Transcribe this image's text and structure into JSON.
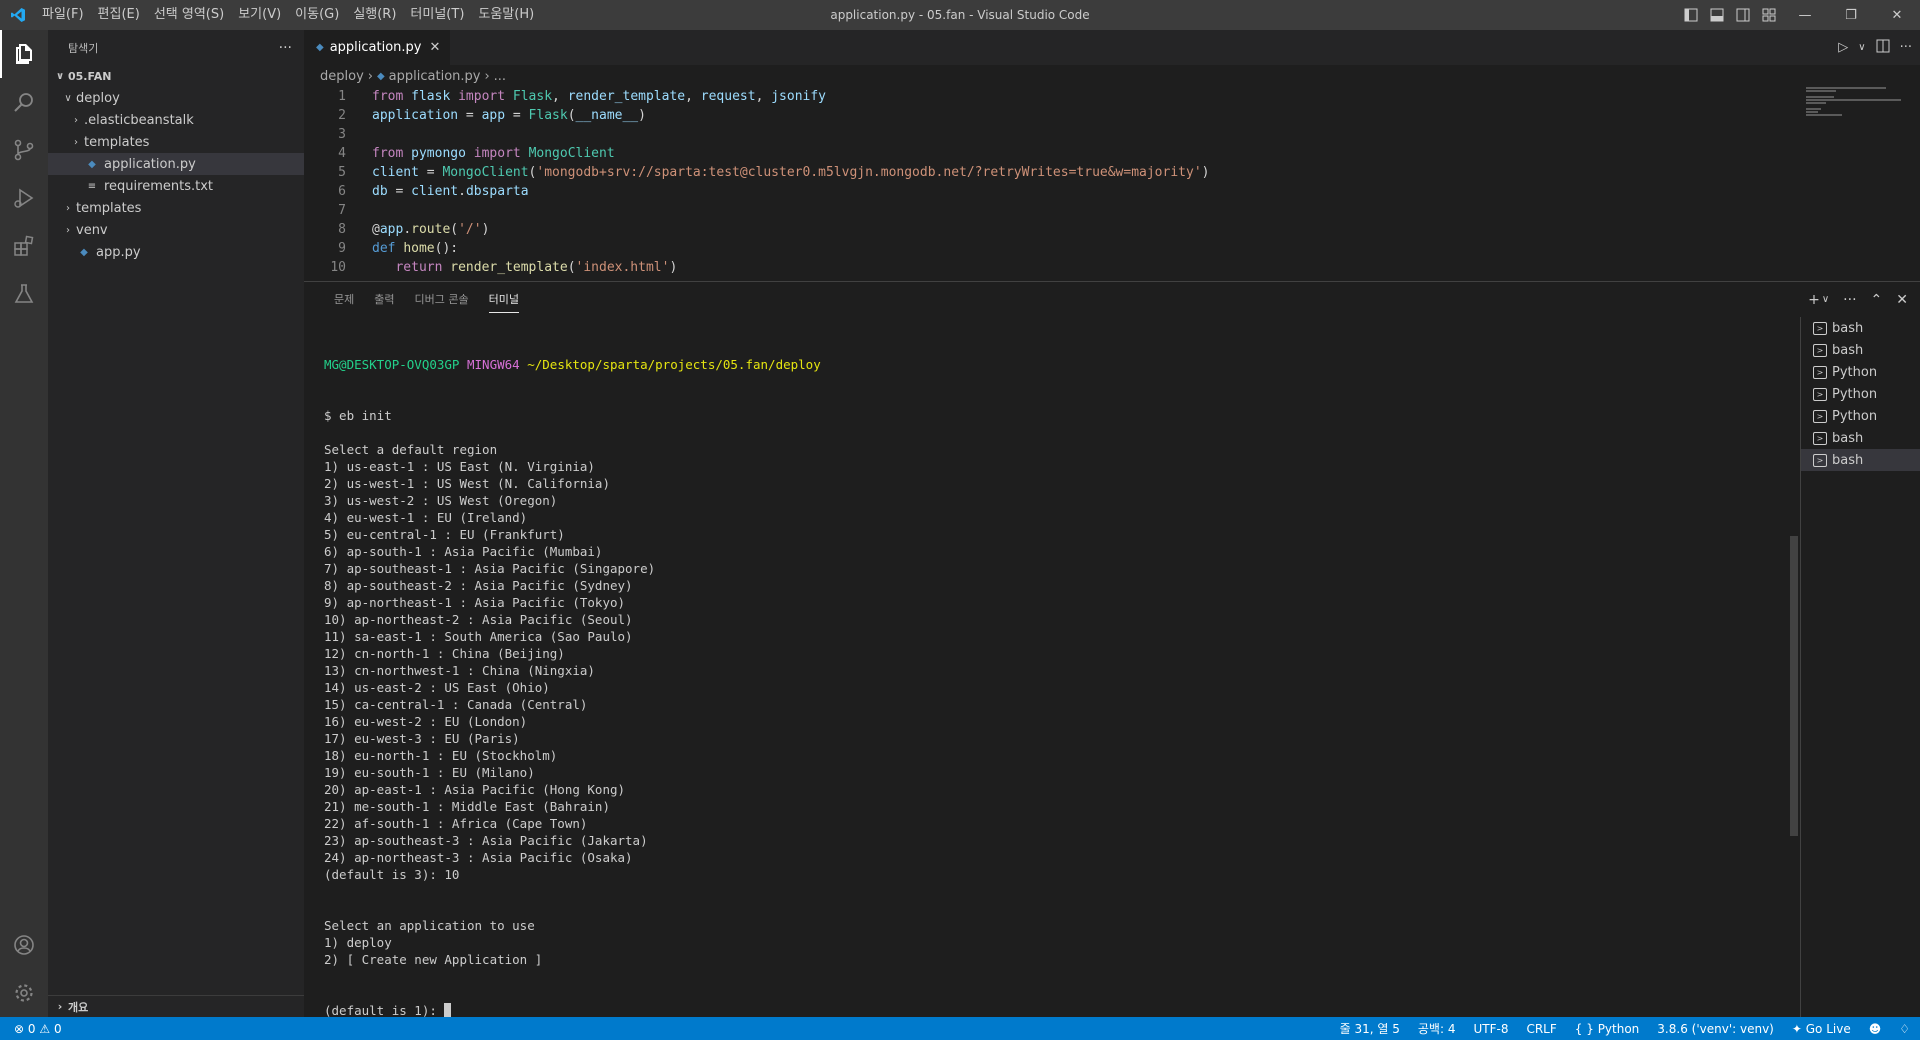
{
  "window": {
    "title": "application.py - 05.fan - Visual Studio Code",
    "menu": [
      "파일(F)",
      "편집(E)",
      "선택 영역(S)",
      "보기(V)",
      "이동(G)",
      "실행(R)",
      "터미널(T)",
      "도움말(H)"
    ]
  },
  "sidebar": {
    "title": "탐색기",
    "more": "···",
    "root": "05.FAN",
    "tree": [
      {
        "label": "deploy",
        "depth": 1,
        "type": "folder-open"
      },
      {
        "label": ".elasticbeanstalk",
        "depth": 2,
        "type": "folder"
      },
      {
        "label": "templates",
        "depth": 2,
        "type": "folder"
      },
      {
        "label": "application.py",
        "depth": 2,
        "type": "python",
        "selected": true
      },
      {
        "label": "requirements.txt",
        "depth": 2,
        "type": "text"
      },
      {
        "label": "templates",
        "depth": 1,
        "type": "folder"
      },
      {
        "label": "venv",
        "depth": 1,
        "type": "folder"
      },
      {
        "label": "app.py",
        "depth": 1,
        "type": "python"
      }
    ],
    "outline": "개요"
  },
  "editor": {
    "tab": "application.py",
    "breadcrumb": [
      "deploy",
      "application.py",
      "..."
    ],
    "lines": [
      {
        "n": "1",
        "code": "from flask import Flask, render_template, request, jsonify"
      },
      {
        "n": "2",
        "code": "application = app = Flask(__name__)"
      },
      {
        "n": "3",
        "code": ""
      },
      {
        "n": "4",
        "code": "from pymongo import MongoClient"
      },
      {
        "n": "5",
        "code": "client = MongoClient('mongodb+srv://sparta:test@cluster0.m5lvgjn.mongodb.net/?retryWrites=true&w=majority')"
      },
      {
        "n": "6",
        "code": "db = client.dbsparta"
      },
      {
        "n": "7",
        "code": ""
      },
      {
        "n": "8",
        "code": "@app.route('/')"
      },
      {
        "n": "9",
        "code": "def home():"
      },
      {
        "n": "10",
        "code": "   return render_template('index.html')"
      }
    ]
  },
  "panel": {
    "tabs": [
      "문제",
      "출력",
      "디버그 콘솔",
      "터미널"
    ],
    "active_tab": "터미널",
    "prompt": {
      "user": "MG@DESKTOP-OVQ03GP",
      "shell": "MINGW64",
      "path": "~/Desktop/sparta/projects/05.fan/deploy"
    },
    "terminal_lines": [
      "$ eb init",
      "",
      "Select a default region",
      "1) us-east-1 : US East (N. Virginia)",
      "2) us-west-1 : US West (N. California)",
      "3) us-west-2 : US West (Oregon)",
      "4) eu-west-1 : EU (Ireland)",
      "5) eu-central-1 : EU (Frankfurt)",
      "6) ap-south-1 : Asia Pacific (Mumbai)",
      "7) ap-southeast-1 : Asia Pacific (Singapore)",
      "8) ap-southeast-2 : Asia Pacific (Sydney)",
      "9) ap-northeast-1 : Asia Pacific (Tokyo)",
      "10) ap-northeast-2 : Asia Pacific (Seoul)",
      "11) sa-east-1 : South America (Sao Paulo)",
      "12) cn-north-1 : China (Beijing)",
      "13) cn-northwest-1 : China (Ningxia)",
      "14) us-east-2 : US East (Ohio)",
      "15) ca-central-1 : Canada (Central)",
      "16) eu-west-2 : EU (London)",
      "17) eu-west-3 : EU (Paris)",
      "18) eu-north-1 : EU (Stockholm)",
      "19) eu-south-1 : EU (Milano)",
      "20) ap-east-1 : Asia Pacific (Hong Kong)",
      "21) me-south-1 : Middle East (Bahrain)",
      "22) af-south-1 : Africa (Cape Town)",
      "23) ap-southeast-3 : Asia Pacific (Jakarta)",
      "24) ap-northeast-3 : Asia Pacific (Osaka)",
      "(default is 3): 10",
      "",
      "",
      "Select an application to use",
      "1) deploy",
      "2) [ Create new Application ]"
    ],
    "last_line": "(default is 1): ",
    "terminals": [
      "bash",
      "bash",
      "Python",
      "Python",
      "Python",
      "bash",
      "bash"
    ],
    "active_terminal_index": 6
  },
  "statusbar": {
    "errors": "0",
    "warnings": "0",
    "position": "줄 31, 열 5",
    "spaces": "공백: 4",
    "encoding": "UTF-8",
    "eol": "CRLF",
    "language": "Python",
    "interpreter": "3.8.6 ('venv': venv)",
    "golive": "Go Live"
  },
  "colors": {
    "accent": "#007acc",
    "activity": "#333333",
    "sidebar": "#252526",
    "editor": "#1e1e1e"
  }
}
